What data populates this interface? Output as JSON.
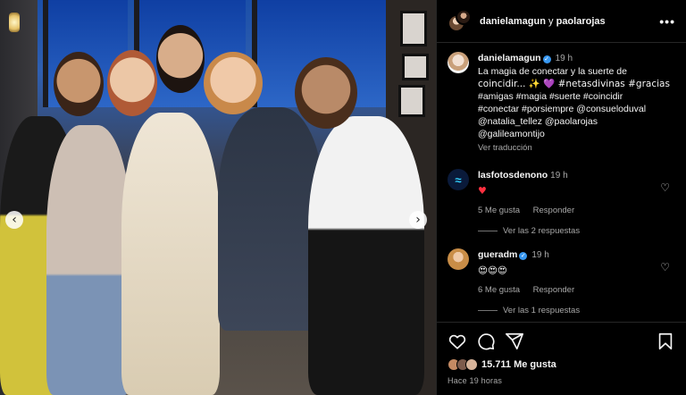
{
  "post": {
    "authors_line": {
      "user1": "danielamagun",
      "joiner": "y",
      "user2": "paolarojas"
    },
    "more_label": "•••",
    "caption": {
      "username": "danielamagun",
      "time": "19 h",
      "lines": [
        "La magia de conectar y la suerte de",
        "coincidir... ✨ 💜 #netasdivinas #gracias",
        "#amigas #magia #suerte #coincidir",
        "#conectar #porsiempre @consueloduval",
        "@natalia_tellez @paolarojas",
        "@galileamontijo"
      ],
      "see_translation": "Ver traducción"
    },
    "comments": [
      {
        "username": "lasfotosdenono",
        "time": "19 h",
        "text": "♥",
        "likes": "5 Me gusta",
        "reply_label": "Responder",
        "replies_label": "Ver las 2 respuestas"
      },
      {
        "username": "gueradm",
        "time": "19 h",
        "text": "😍😍😍",
        "likes": "6 Me gusta",
        "reply_label": "Responder",
        "replies_label": "Ver las 1 respuestas"
      }
    ],
    "likes_count": "15.711 Me gusta",
    "time_ago": "Hace 19 horas"
  },
  "icons": {
    "like": "heart-icon",
    "comment": "comment-icon",
    "share": "share-icon",
    "save": "bookmark-icon",
    "prev": "chevron-left-icon",
    "next": "chevron-right-icon"
  },
  "colors": {
    "background": "#000000",
    "text": "#f5f5f5",
    "muted": "#a8a8a8",
    "verified": "#3797f0",
    "emoji_heart": "#ff3040"
  }
}
